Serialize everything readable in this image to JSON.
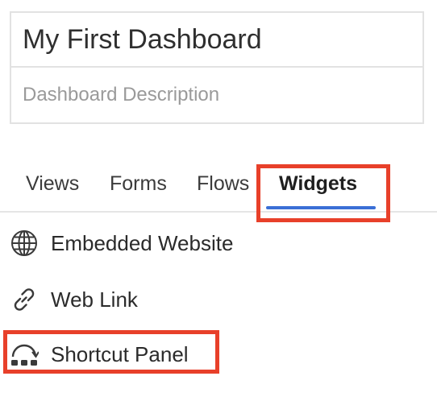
{
  "dashboard": {
    "title_value": "My First Dashboard",
    "description_placeholder": "Dashboard Description"
  },
  "tabs": [
    {
      "label": "Views",
      "active": false
    },
    {
      "label": "Forms",
      "active": false
    },
    {
      "label": "Flows",
      "active": false
    },
    {
      "label": "Widgets",
      "active": true
    }
  ],
  "widgets": [
    {
      "label": "Embedded Website",
      "icon": "globe-icon"
    },
    {
      "label": "Web Link",
      "icon": "link-icon"
    },
    {
      "label": "Shortcut Panel",
      "icon": "shortcut-panel-icon"
    }
  ],
  "colors": {
    "accent": "#3a6fd6",
    "highlight": "#e8402a",
    "text": "#2b2b2b",
    "placeholder": "#9a9a9a",
    "border": "#e2e2e2"
  }
}
